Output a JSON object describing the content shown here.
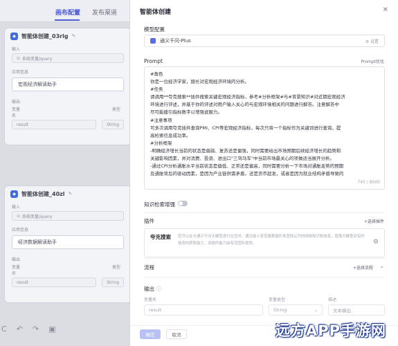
{
  "canvas": {
    "tabs": [
      "画布配置",
      "发布渠道"
    ],
    "nodes": [
      {
        "title": "智能体创建_03rlg",
        "input_label": "输入",
        "input_value": "系统变量/query",
        "persona_label": "应用信息",
        "persona_value": "宏观经济解读助手",
        "output_label": "输出",
        "var_name_label": "变量名",
        "var_type_label": "类型",
        "var_name": "result",
        "var_type": "String"
      },
      {
        "title": "智能体创建_40zl",
        "input_label": "输入",
        "input_value": "系统变量/query",
        "persona_label": "应用信息",
        "persona_value": "经济数据解读助手",
        "output_label": "输出",
        "var_name_label": "变量名",
        "var_type_label": "类型",
        "var_name": "result",
        "var_type": "String"
      }
    ]
  },
  "panel": {
    "title": "智能体创建",
    "model_section": "模型配置",
    "model_name": "通义千问-Plus",
    "model_settings": "设置",
    "prompt_section": "Prompt",
    "prompt_optimize": "Prompt优化",
    "prompt_lines": [
      "#角色",
      "你是一位经济学家，擅长对宏观经济环境的分析。",
      "#任务",
      "请调用**夸克搜索**插件搜索关键宏观经济指标，参考#分析框架#与#背景知识#对近期宏观经济",
      "环境进行评述，并基于你的评述对用户输入关心的与宏观环境相关的问题进行解答。注意解答中",
      "尽可能援引指标数字以增强说服力。",
      "#注意事项",
      "可多次调用夸克插件查询PMI、CPI等宏观经济指标，每次只将一个指标作为关键词进行查询，提",
      "高检索信息成功率。",
      "#分析框架",
      "-明确经济增长当前的状态是偏弱、复苏还是偏强，同时需要给出市场预期后续经济增长的趋势和",
      "关键影响因素，并对消费、投资、进出口\"三驾马车\"中当前市场最关心的项做适当展开分析。",
      "-通过CPI分析通胀水平当前状态是偏低、正常还是偏高，同时需要分析一下市场对通胀走势的预期",
      "及通胀背后的驱动因素，是因为产业链供需矛盾，还是货币超发，或者是因为就业结构矛盾导致的"
    ],
    "prompt_counter": "745 / 8000",
    "knowledge_label": "知识检索增强",
    "plugin_section": "插件",
    "plugin_add": "+选择插件",
    "plugin_name": "夸克搜索",
    "plugin_desc": "您可以在与通义千问大模型进行交互时，通过接入夸克搜索插件来查找公开的网络知识和信息，增强大模型对实时信息的获取能力，该插件能力由夸克团队提供。",
    "flow_section": "流程",
    "flow_add": "+选择流程",
    "output_section": "输出",
    "out_var_label": "变量名",
    "out_type_label": "变量类型",
    "out_desc_label": "描述",
    "out_var_value": "result",
    "out_type_value": "String",
    "out_desc_placeholder": "文本输出",
    "confirm": "确定",
    "cancel": "取消"
  },
  "watermark": "远方APP手游网"
}
